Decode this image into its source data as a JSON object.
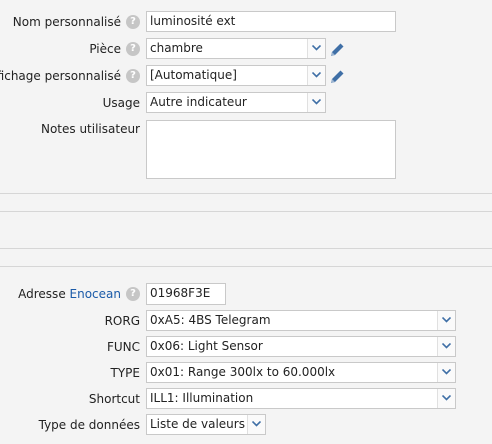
{
  "general": {
    "name": {
      "label": "Nom personnalisé",
      "value": "luminosité ext"
    },
    "room": {
      "label": "Pièce",
      "value": "chambre"
    },
    "display": {
      "label": "Affichage personnalisé",
      "value": "[Automatique]"
    },
    "usage": {
      "label": "Usage",
      "value": "Autre indicateur"
    },
    "notes": {
      "label": "Notes utilisateur",
      "value": ""
    }
  },
  "enocean": {
    "address": {
      "label_prefix": "Adresse",
      "label_link": "Enocean",
      "value": "01968F3E"
    },
    "rorg": {
      "label": "RORG",
      "value": "0xA5: 4BS Telegram"
    },
    "func": {
      "label": "FUNC",
      "value": "0x06: Light Sensor"
    },
    "type": {
      "label": "TYPE",
      "value": "0x01: Range 300lx to 60.000lx"
    },
    "shortcut": {
      "label": "Shortcut",
      "value": "ILL1: Illumination"
    },
    "datatype": {
      "label": "Type de données",
      "value": "Liste de valeurs"
    }
  },
  "icons": {
    "help": "help-icon",
    "edit": "pencil-icon",
    "dropdown": "chevron-down-icon"
  },
  "colors": {
    "link": "#1a5aa8",
    "pencil": "#3f6fa6",
    "help": "#c6c6c6"
  }
}
